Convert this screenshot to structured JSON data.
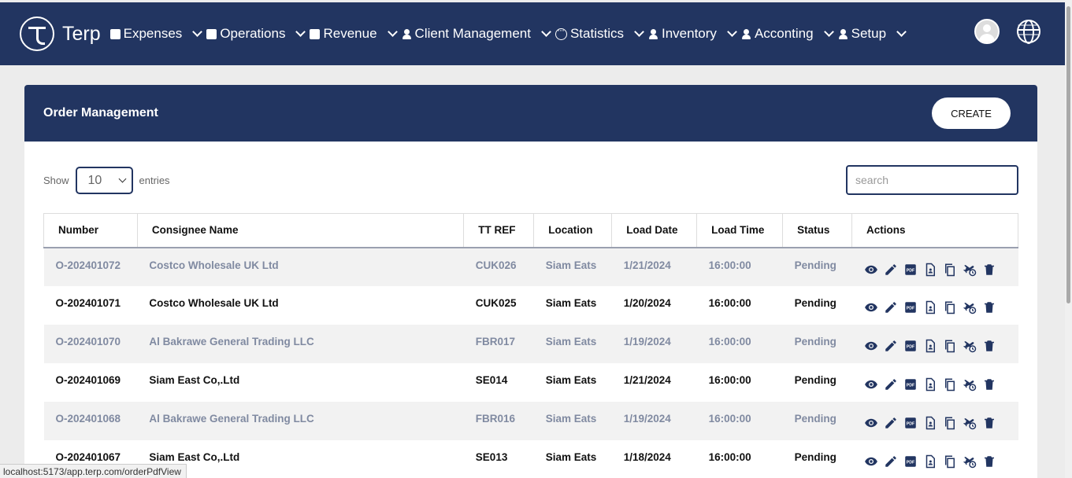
{
  "brand": {
    "name": "Terp"
  },
  "nav": [
    {
      "label": "Expenses",
      "icon": "gift-icon"
    },
    {
      "label": "Operations",
      "icon": "gift-icon"
    },
    {
      "label": "Revenue",
      "icon": "archive-icon"
    },
    {
      "label": "Client Management",
      "icon": "person-add-icon"
    },
    {
      "label": "Statistics",
      "icon": "circle-dots-icon"
    },
    {
      "label": "Inventory",
      "icon": "person-icon"
    },
    {
      "label": "Acconting",
      "icon": "person-icon"
    },
    {
      "label": "Setup",
      "icon": "person-icon"
    }
  ],
  "card": {
    "title": "Order Management",
    "create_label": "CREATE"
  },
  "controls": {
    "show_label": "Show",
    "entries_value": "10",
    "entries_label": "entries",
    "search_placeholder": "search"
  },
  "table": {
    "headers": [
      "Number",
      "Consignee Name",
      "TT REF",
      "Location",
      "Load Date",
      "Load Time",
      "Status",
      "Actions"
    ],
    "rows": [
      {
        "number": "O-202401072",
        "consignee": "Costco Wholesale UK Ltd",
        "ttref": "CUK026",
        "location": "Siam Eats",
        "date": "1/21/2024",
        "time": "16:00:00",
        "status": "Pending"
      },
      {
        "number": "O-202401071",
        "consignee": "Costco Wholesale UK Ltd",
        "ttref": "CUK025",
        "location": "Siam Eats",
        "date": "1/20/2024",
        "time": "16:00:00",
        "status": "Pending"
      },
      {
        "number": "O-202401070",
        "consignee": "Al Bakrawe General Trading LLC",
        "ttref": "FBR017",
        "location": "Siam Eats",
        "date": "1/19/2024",
        "time": "16:00:00",
        "status": "Pending"
      },
      {
        "number": "O-202401069",
        "consignee": "Siam East Co,.Ltd",
        "ttref": "SE014",
        "location": "Siam Eats",
        "date": "1/21/2024",
        "time": "16:00:00",
        "status": "Pending"
      },
      {
        "number": "O-202401068",
        "consignee": "Al Bakrawe General Trading LLC",
        "ttref": "FBR016",
        "location": "Siam Eats",
        "date": "1/19/2024",
        "time": "16:00:00",
        "status": "Pending"
      },
      {
        "number": "O-202401067",
        "consignee": "Siam East Co,.Ltd",
        "ttref": "SE013",
        "location": "Siam Eats",
        "date": "1/18/2024",
        "time": "16:00:00",
        "status": "Pending"
      }
    ]
  },
  "status_url": "localhost:5173/app.terp.com/orderPdfView",
  "colors": {
    "primary": "#223561",
    "muted_text": "#808aa1"
  }
}
